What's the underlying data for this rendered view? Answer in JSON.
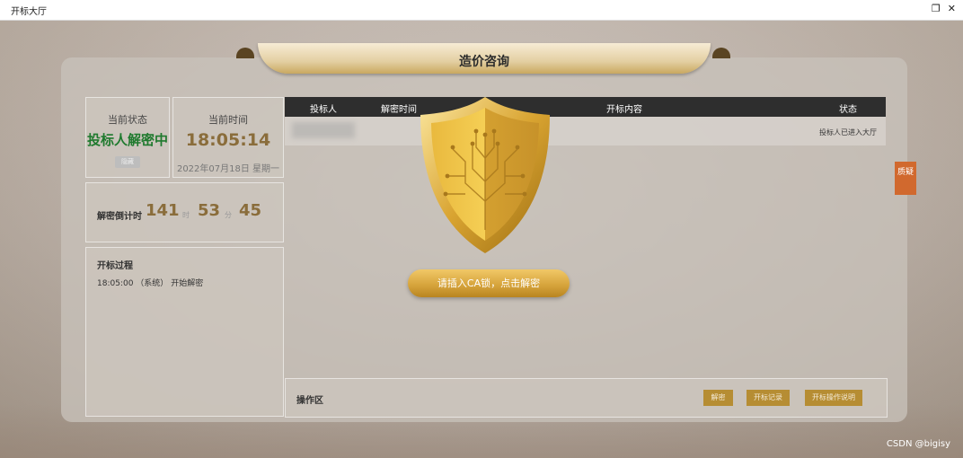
{
  "window": {
    "title": "开标大厅",
    "controls": {
      "restore": "❐",
      "close": "✕"
    }
  },
  "header": {
    "title": "造价咨询"
  },
  "status_card": {
    "label": "当前状态",
    "value": "投标人解密中",
    "hide_button": "隐藏"
  },
  "time_card": {
    "label": "当前时间",
    "time": "18:05:14",
    "date": "2022年07月18日 星期一"
  },
  "countdown": {
    "label": "解密倒计时",
    "minutes": "141",
    "minutes_unit": "时",
    "seconds": "53",
    "seconds_unit": "分",
    "extra": "45"
  },
  "process": {
    "title": "开标过程",
    "items": [
      {
        "time": "18:05:00",
        "actor": "（系统）",
        "text": "开始解密"
      }
    ]
  },
  "table": {
    "columns": [
      "投标人",
      "解密时间",
      "开标内容",
      "状态"
    ],
    "rows": [
      {
        "bidder": "",
        "decrypt_time": "",
        "content": "",
        "status": "投标人已进入大厅"
      }
    ]
  },
  "operations": {
    "label": "操作区",
    "buttons": [
      "解密",
      "开标记录",
      "开标操作说明"
    ]
  },
  "side_tab": {
    "label": "质疑"
  },
  "decrypt_prompt": {
    "label": "请插入CA锁，点击解密"
  },
  "watermark": {
    "text": "CSDN @bigisy"
  },
  "colors": {
    "status_green": "#1f7a2e",
    "gold": "#8a6d3b",
    "button_gold": "#b68d33",
    "side_tab_orange": "#d1692e"
  },
  "icons": {
    "shield": "circuit-tree-shield-icon"
  }
}
